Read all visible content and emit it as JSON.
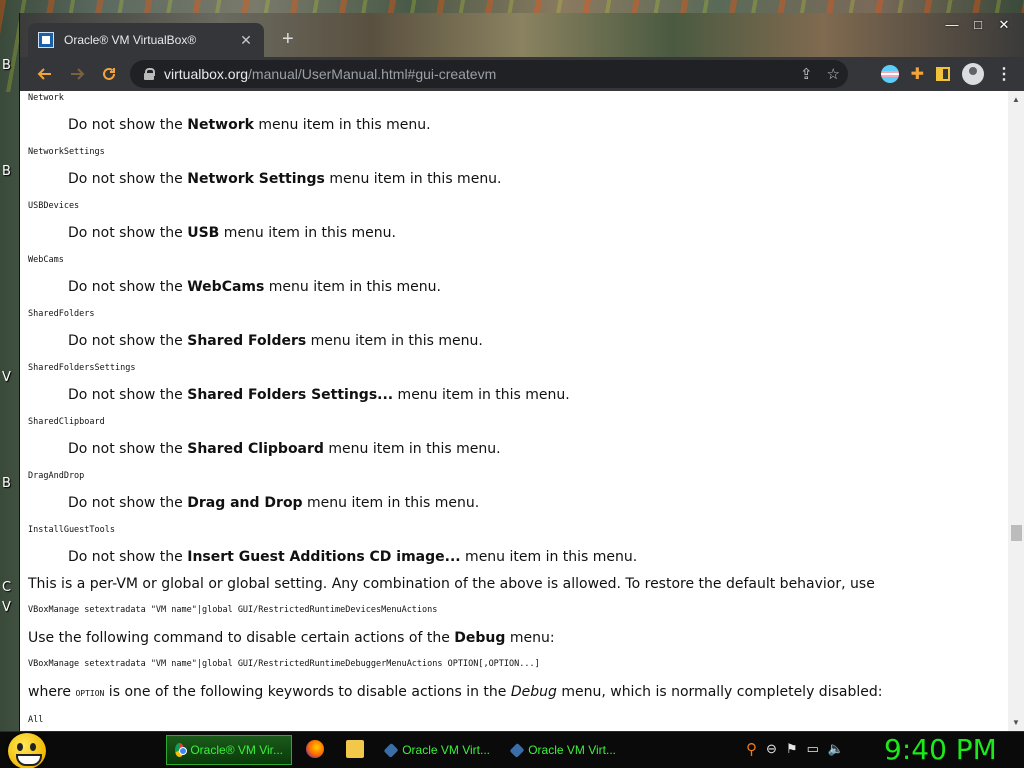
{
  "desktop": {
    "labels": [
      "B",
      "B",
      "V",
      "B",
      "C",
      "V"
    ]
  },
  "browser": {
    "tab_title": "Oracle® VM VirtualBox®",
    "tab_close": "✕",
    "new_tab": "+",
    "window_controls": {
      "minimize": "—",
      "maximize": "□",
      "close": "✕"
    },
    "url_host": "virtualbox.org",
    "url_path": "/manual/UserManual.html#gui-createvm"
  },
  "page": {
    "items": [
      {
        "term": "Network",
        "pre": "Do not show the ",
        "bold": "Network",
        "post": " menu item in this menu."
      },
      {
        "term": "NetworkSettings",
        "pre": "Do not show the ",
        "bold": "Network Settings",
        "post": " menu item in this menu."
      },
      {
        "term": "USBDevices",
        "pre": "Do not show the ",
        "bold": "USB",
        "post": " menu item in this menu."
      },
      {
        "term": "WebCams",
        "pre": "Do not show the ",
        "bold": "WebCams",
        "post": " menu item in this menu."
      },
      {
        "term": "SharedFolders",
        "pre": "Do not show the ",
        "bold": "Shared Folders",
        "post": " menu item in this menu."
      },
      {
        "term": "SharedFoldersSettings",
        "pre": "Do not show the ",
        "bold": "Shared Folders Settings...",
        "post": " menu item in this menu."
      },
      {
        "term": "SharedClipboard",
        "pre": "Do not show the ",
        "bold": "Shared Clipboard",
        "post": " menu item in this menu."
      },
      {
        "term": "DragAndDrop",
        "pre": "Do not show the ",
        "bold": "Drag and Drop",
        "post": " menu item in this menu."
      },
      {
        "term": "InstallGuestTools",
        "pre": "Do not show the ",
        "bold": "Insert Guest Additions CD image...",
        "post": " menu item in this menu."
      }
    ],
    "para1": "This is a per-VM or global or global setting. Any combination of the above is allowed. To restore the default behavior, use",
    "code1": "VBoxManage setextradata \"VM name\"|global GUI/RestrictedRuntimeDevicesMenuActions",
    "para2_pre": "Use the following command to disable certain actions of the ",
    "para2_bold": "Debug",
    "para2_post": " menu:",
    "code2": "VBoxManage setextradata \"VM name\"|global GUI/RestrictedRuntimeDebuggerMenuActions OPTION[,OPTION...]",
    "para3_pre": "where ",
    "para3_code": "OPTION",
    "para3_mid": " is one of the following keywords to disable actions in the ",
    "para3_em": "Debug",
    "para3_post": " menu, which is normally completely disabled:",
    "term_last": "All"
  },
  "taskbar": {
    "tasks": [
      {
        "label": "Oracle® VM Vir...",
        "icon": "chrome-icon",
        "active": true
      },
      {
        "label": "Oracle VM Virt...",
        "icon": "virtualbox-icon",
        "active": false
      },
      {
        "label": "Oracle VM Virt...",
        "icon": "virtualbox-icon",
        "active": false
      }
    ],
    "tray_icons": [
      "search-icon",
      "network-icon",
      "flag-icon",
      "display-icon",
      "volume-icon"
    ],
    "clock": "9:40 PM"
  },
  "colors": {
    "accent_orange": "#f2a33a",
    "clock_green": "#1ce81c",
    "task_green": "#3cf03c"
  }
}
